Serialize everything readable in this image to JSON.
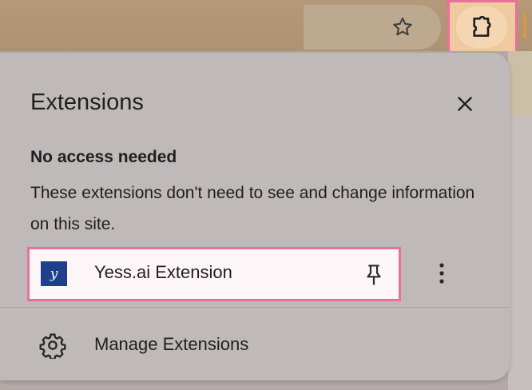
{
  "toolbar": {
    "bookmark_icon": "star-icon",
    "extensions_icon": "puzzle-piece-icon",
    "highlight_color": "#e8709a"
  },
  "popup": {
    "title": "Extensions",
    "close_icon": "close-icon",
    "section": {
      "heading": "No access needed",
      "description": "These extensions don't need to see and change information on this site."
    },
    "extensions": [
      {
        "name": "Yess.ai Extension",
        "logo_text": "y",
        "logo_color": "#1e3f8a",
        "pin_icon": "pin-icon",
        "menu_icon": "more-vert-icon"
      }
    ],
    "manage": {
      "label": "Manage Extensions",
      "icon": "gear-icon"
    }
  }
}
